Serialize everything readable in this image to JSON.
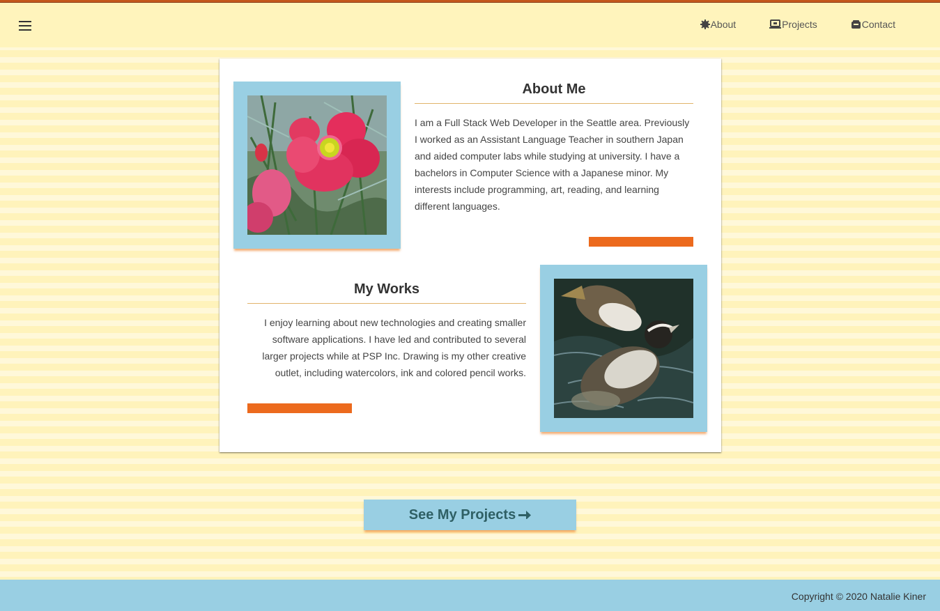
{
  "nav": {
    "menu_icon": "hamburger-icon",
    "items": [
      {
        "label": "About",
        "icon": "gear-icon"
      },
      {
        "label": "Projects",
        "icon": "laptop-icon"
      },
      {
        "label": "Contact",
        "icon": "mailbox-icon"
      }
    ]
  },
  "about": {
    "title": "About Me",
    "text": "I am a Full Stack Web Developer in the Seattle area. Previously I worked as an Assistant Language Teacher in southern Japan and aided computer labs while studying at university. I have a bachelors in Computer Science with a Japanese minor. My interests include programming, art, reading, and learning different languages."
  },
  "works": {
    "title": "My Works",
    "text": "I enjoy learning about new technologies and creating smaller software applications. I have led and contributed to several larger projects while at PSP Inc. Drawing is my other creative outlet, including watercolors, ink and colored pencil works."
  },
  "cta": {
    "label": "See My Projects",
    "icon": "arrow-right-icon"
  },
  "footer": {
    "copyright": "Copyright © 2020 Natalie Kiner"
  },
  "colors": {
    "background": "#fff3bb",
    "frame": "#99cfe3",
    "accent": "#ec6a1d",
    "heading": "#333333"
  }
}
